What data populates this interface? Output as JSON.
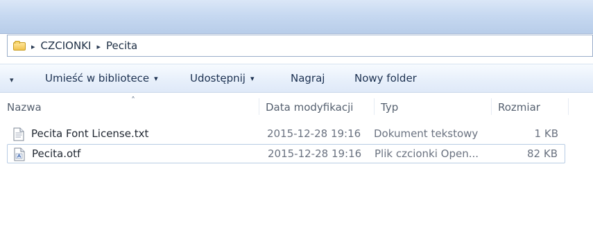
{
  "addressbar": {
    "folder_icon": "folder-icon",
    "breadcrumb_separator": "▸",
    "crumbs": [
      "CZCIONKI",
      "Pecita"
    ]
  },
  "toolbar": {
    "left_arrow": "▾",
    "items": [
      {
        "label": "Umieść w bibliotece",
        "arrow": "▾"
      },
      {
        "label": "Udostępnij",
        "arrow": "▾"
      },
      {
        "label": "Nagraj"
      },
      {
        "label": "Nowy folder"
      }
    ]
  },
  "columns": {
    "name": "Nazwa",
    "date": "Data modyfikacji",
    "type": "Typ",
    "size": "Rozmiar",
    "sort_indicator": "˄"
  },
  "files": [
    {
      "name": "Pecita Font License.txt",
      "date": "2015-12-28 19:16",
      "type": "Dokument tekstowy",
      "size": "1 KB",
      "icon": "text-file-icon"
    },
    {
      "name": "Pecita.otf",
      "date": "2015-12-28 19:16",
      "type": "Plik czcionki Open...",
      "size": "82 KB",
      "icon": "font-file-icon"
    }
  ]
}
